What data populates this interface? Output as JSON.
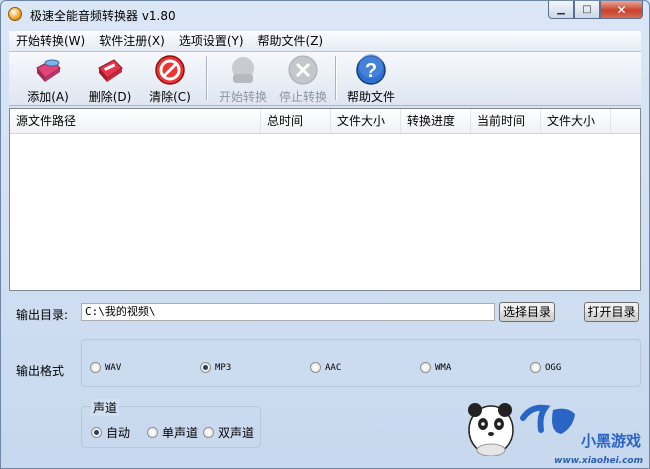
{
  "window": {
    "title": "极速全能音频转换器 v1.80"
  },
  "menu": [
    "开始转换(W)",
    "软件注册(X)",
    "选项设置(Y)",
    "帮助文件(Z)"
  ],
  "toolbar": {
    "add": "添加(A)",
    "delete": "删除(D)",
    "clear": "清除(C)",
    "start": "开始转换",
    "stop": "停止转换",
    "help": "帮助文件"
  },
  "list": {
    "columns": [
      "源文件路径",
      "总时间",
      "文件大小",
      "转换进度",
      "当前时间",
      "文件大小"
    ]
  },
  "output": {
    "dir_label": "输出目录:",
    "dir_value": "C:\\我的视频\\",
    "choose_button": "选择目录",
    "open_button": "打开目录",
    "format_label": "输出格式",
    "formats": [
      "WAV",
      "MP3",
      "AAC",
      "WMA",
      "OGG"
    ],
    "selected_format": "MP3"
  },
  "channel": {
    "title": "声道",
    "options": [
      "自动",
      "单声道",
      "双声道"
    ],
    "selected": "自动"
  },
  "watermark": {
    "brand": "小黑游戏",
    "url": "www.xiaohei.com"
  }
}
